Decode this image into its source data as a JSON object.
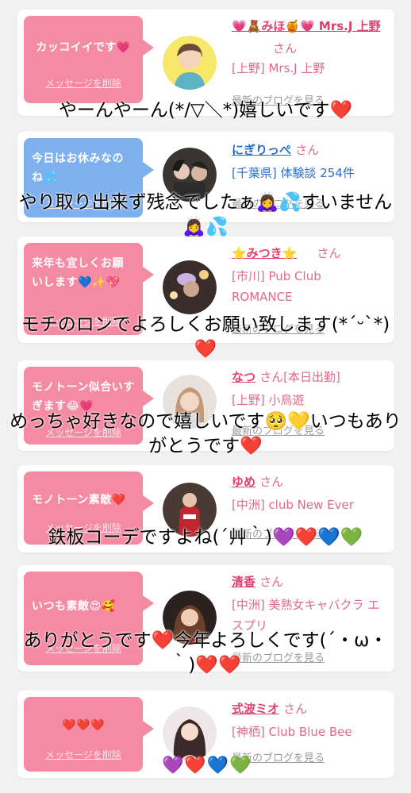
{
  "cards": [
    {
      "bubble": "カッコイイです💗",
      "bubble_color": "pink",
      "delete": "メッセージを削除",
      "name": "💗🧸みほ🍯💗 Mrs.J 上野",
      "san": "さん",
      "shop": "[上野] Mrs.J 上野",
      "blog": "最新のブログを見る",
      "overlay": "やーんやーん(*/▽＼*)嬉しいです❤️"
    },
    {
      "bubble": "今日はお休みなのね💦",
      "bubble_color": "blue",
      "delete": "メッセージを削除",
      "name": "にぎりっぺ",
      "san": "さん",
      "shop": "[千葉県] 体験談 254件",
      "blog": "最新のブログを見る",
      "overlay": "やり取り出来ず残念でしたぁ🙇‍♀️💦すいません🙇‍♀️💦"
    },
    {
      "bubble": "来年も宜しくお願いします💙✨💖",
      "bubble_color": "pink",
      "delete": "メッセージを削除",
      "name": "⭐️みつき⭐️",
      "san": "さん",
      "shop": "[市川] Pub Club ROMANCE",
      "blog": "最新のブログを見る",
      "overlay": "モチのロンでよろしくお願い致します(*ˊᵕˋ*)❤️"
    },
    {
      "bubble": "モノトーン似合いすぎます😂💗",
      "bubble_color": "pink",
      "delete": "メッセージを削除",
      "name": "なつ",
      "san": "さん[本日出勤]",
      "shop": "[上野] 小鳥遊",
      "blog": "最新のブログを見る",
      "overlay": "めっちゃ好きなので嬉しいです🥺💛いつもありがとうです❤️"
    },
    {
      "bubble": "モノトーン素敵❤️",
      "bubble_color": "pink",
      "delete": "メッセージを削除",
      "name": "ゆめ",
      "san": "さん",
      "shop": "[中洲] club New Ever",
      "blog": "最新のブログを見る",
      "overlay": "鉄板コーデですよね(´艸｀)💜❤️💙💚"
    },
    {
      "bubble": "いつも素敵😍🥰",
      "bubble_color": "pink",
      "delete": "メッセージを削除",
      "name": "清香",
      "san": "さん",
      "shop": "[中洲] 美熟女キャバクラ エスプリ",
      "blog": "最新のブログを見る",
      "overlay": "ありがとうです❤️今年よろしくです(´・ω・｀)❤️❤️"
    },
    {
      "bubble": "❤️❤️❤️",
      "bubble_color": "pink",
      "delete": "メッセージを削除",
      "name": "式波ミオ",
      "san": "さん",
      "shop": "[神栖] Club Blue Bee",
      "blog": "最新のブログを見る",
      "overlay": "💜❤️💙💚"
    }
  ]
}
